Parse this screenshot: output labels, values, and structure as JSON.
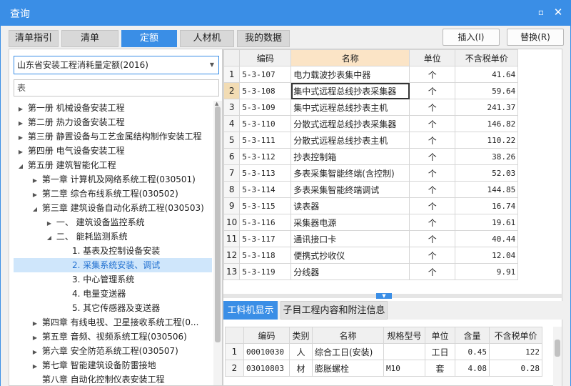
{
  "window": {
    "title": "查询",
    "minimize_glyph": "▫",
    "close_glyph": "✕"
  },
  "tabs": [
    {
      "label": "清单指引",
      "active": false
    },
    {
      "label": "清单",
      "active": false
    },
    {
      "label": "定额",
      "active": true
    },
    {
      "label": "人材机",
      "active": false
    },
    {
      "label": "我的数据",
      "active": false
    }
  ],
  "buttons": {
    "insert": "插入(I)",
    "replace": "替换(R)"
  },
  "quota_select": {
    "value": "山东省安装工程消耗量定额(2016)",
    "arrow": "▼"
  },
  "search": {
    "placeholder": "表"
  },
  "tree": [
    {
      "label": "第一册 机械设备安装工程",
      "level": 0,
      "toggle": "▶",
      "selected": false
    },
    {
      "label": "第二册 热力设备安装工程",
      "level": 0,
      "toggle": "▶",
      "selected": false
    },
    {
      "label": "第三册 静置设备与工艺金属结构制作安装工程",
      "level": 0,
      "toggle": "▶",
      "selected": false
    },
    {
      "label": "第四册 电气设备安装工程",
      "level": 0,
      "toggle": "▶",
      "selected": false
    },
    {
      "label": "第五册 建筑智能化工程",
      "level": 0,
      "toggle": "◢",
      "selected": false
    },
    {
      "label": "第一章 计算机及网络系统工程(030501)",
      "level": 1,
      "toggle": "▶",
      "selected": false
    },
    {
      "label": "第二章 综合布线系统工程(030502)",
      "level": 1,
      "toggle": "▶",
      "selected": false
    },
    {
      "label": "第三章 建筑设备自动化系统工程(030503)",
      "level": 1,
      "toggle": "◢",
      "selected": false
    },
    {
      "label": "一、 建筑设备监控系统",
      "level": 2,
      "toggle": "▶",
      "selected": false
    },
    {
      "label": "二、 能耗监测系统",
      "level": 2,
      "toggle": "◢",
      "selected": false
    },
    {
      "label": "1. 基表及控制设备安装",
      "level": 3,
      "toggle": "",
      "selected": false
    },
    {
      "label": "2. 采集系统安装、调试",
      "level": 3,
      "toggle": "",
      "selected": true
    },
    {
      "label": "3. 中心管理系统",
      "level": 3,
      "toggle": "",
      "selected": false
    },
    {
      "label": "4. 电量变送器",
      "level": 3,
      "toggle": "",
      "selected": false
    },
    {
      "label": "5. 其它传感器及变送器",
      "level": 3,
      "toggle": "",
      "selected": false
    },
    {
      "label": "第四章 有线电视、卫星接收系统工程(0...",
      "level": 1,
      "toggle": "▶",
      "selected": false
    },
    {
      "label": "第五章 音频、视频系统工程(030506)",
      "level": 1,
      "toggle": "▶",
      "selected": false
    },
    {
      "label": "第六章 安全防范系统工程(030507)",
      "level": 1,
      "toggle": "▶",
      "selected": false
    },
    {
      "label": "第七章 智能建筑设备防雷接地",
      "level": 1,
      "toggle": "▶",
      "selected": false
    },
    {
      "label": "第八章 自动化控制仪表安装工程",
      "level": 1,
      "toggle": "",
      "selected": false
    }
  ],
  "main_table": {
    "headers": [
      "",
      "编码",
      "名称",
      "单位",
      "不含税单价"
    ],
    "rows": [
      [
        "1",
        "5-3-107",
        "电力载波抄表集中器",
        "个",
        "41.64"
      ],
      [
        "2",
        "5-3-108",
        "集中式远程总线抄表采集器",
        "个",
        "59.64"
      ],
      [
        "3",
        "5-3-109",
        "集中式远程总线抄表主机",
        "个",
        "241.37"
      ],
      [
        "4",
        "5-3-110",
        "分散式远程总线抄表采集器",
        "个",
        "146.82"
      ],
      [
        "5",
        "5-3-111",
        "分散式远程总线抄表主机",
        "个",
        "110.22"
      ],
      [
        "6",
        "5-3-112",
        "抄表控制箱",
        "个",
        "38.26"
      ],
      [
        "7",
        "5-3-113",
        "多表采集智能终端(含控制)",
        "个",
        "52.03"
      ],
      [
        "8",
        "5-3-114",
        "多表采集智能终端调试",
        "个",
        "144.85"
      ],
      [
        "9",
        "5-3-115",
        "读表器",
        "个",
        "16.74"
      ],
      [
        "10",
        "5-3-116",
        "采集器电源",
        "个",
        "19.61"
      ],
      [
        "11",
        "5-3-117",
        "通讯接口卡",
        "个",
        "40.44"
      ],
      [
        "12",
        "5-3-118",
        "便携式抄收仪",
        "个",
        "12.04"
      ],
      [
        "13",
        "5-3-119",
        "分线器",
        "个",
        "9.91"
      ]
    ],
    "selected_row": 1
  },
  "splitter": {
    "grip": "▼"
  },
  "subtabs": [
    {
      "label": "工料机显示",
      "active": true
    },
    {
      "label": "子目工程内容和附注信息",
      "active": false
    }
  ],
  "sub_table": {
    "headers": [
      "",
      "编码",
      "类别",
      "名称",
      "规格型号",
      "单位",
      "含量",
      "不含税单价"
    ],
    "rows": [
      [
        "1",
        "00010030",
        "人",
        "综合工日(安装)",
        "",
        "工日",
        "0.45",
        "122"
      ],
      [
        "2",
        "03010803",
        "材",
        "膨胀螺栓",
        "M10",
        "套",
        "4.08",
        "0.28"
      ]
    ]
  },
  "colors": {
    "accent": "#3a8ee6",
    "selected_bg": "#cfe6fb",
    "header_hl": "#fbe4c6"
  }
}
